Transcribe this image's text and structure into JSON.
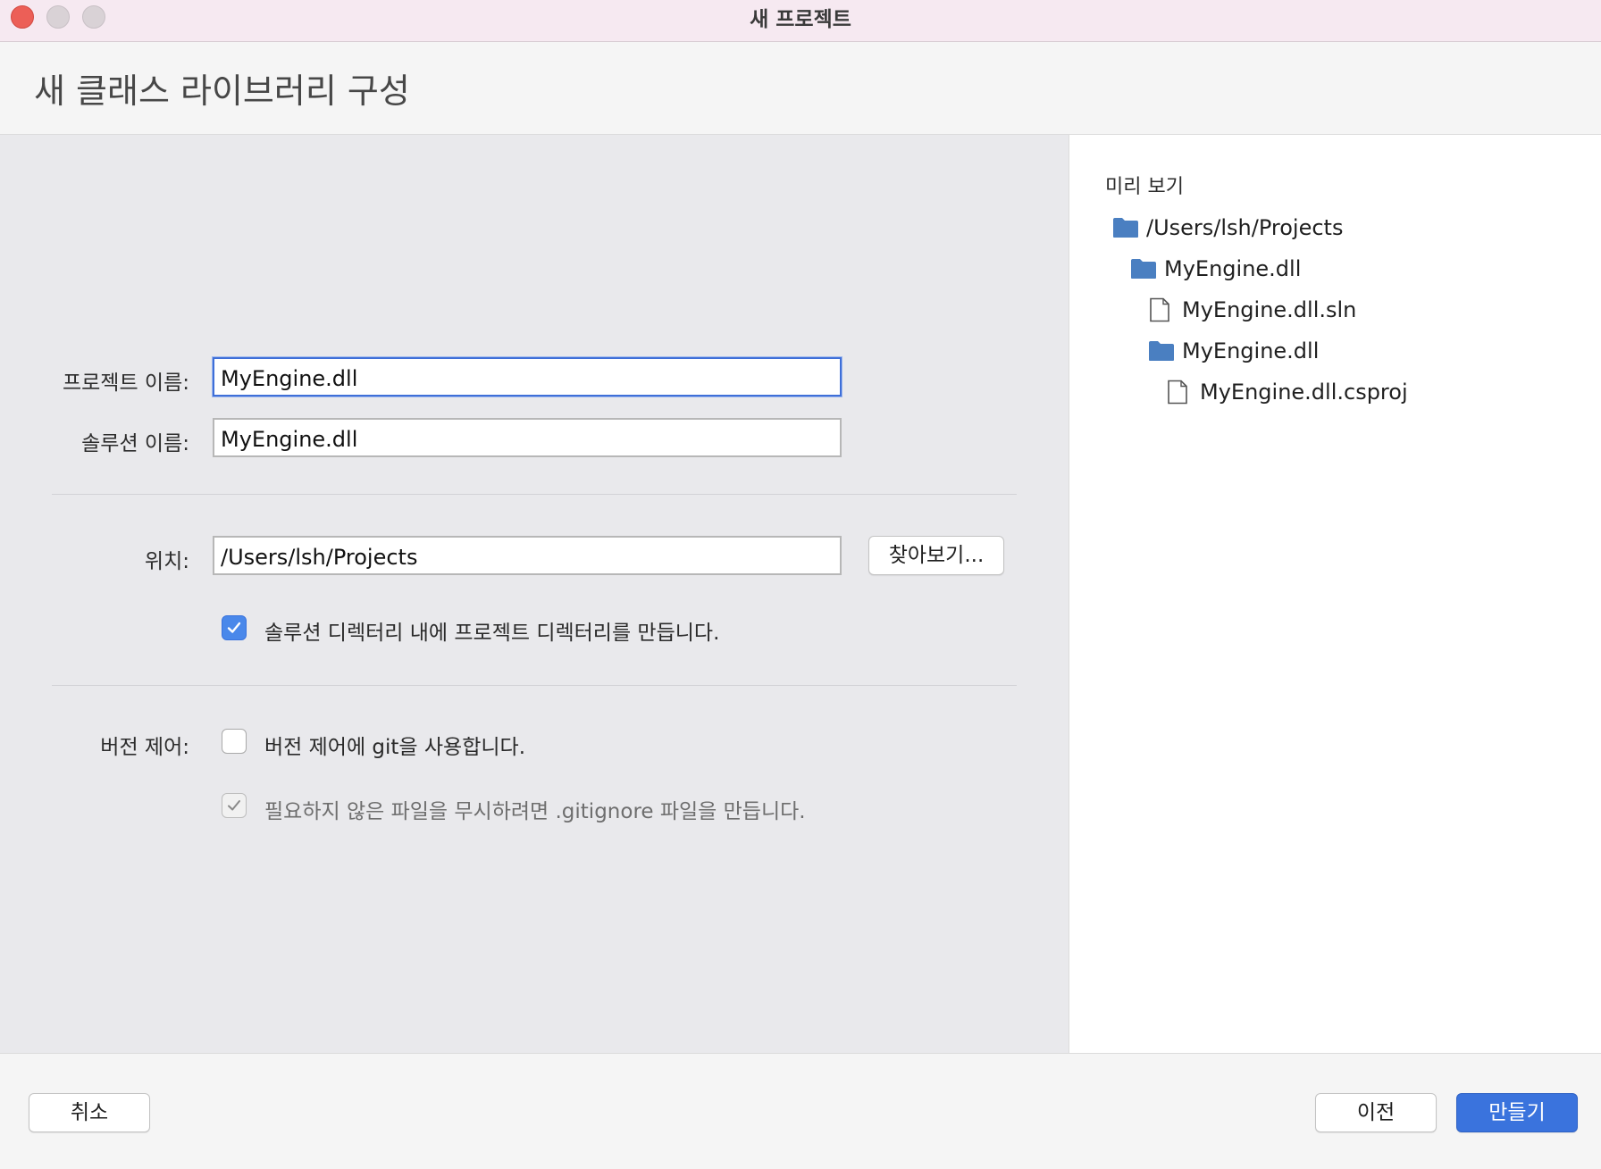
{
  "window": {
    "title": "새 프로젝트"
  },
  "header": {
    "title": "새 클래스 라이브러리 구성"
  },
  "form": {
    "project_name_label": "프로젝트 이름:",
    "project_name_value": "MyEngine.dll",
    "solution_name_label": "솔루션 이름:",
    "solution_name_value": "MyEngine.dll",
    "location_label": "위치:",
    "location_value": "/Users/lsh/Projects",
    "browse_label": "찾아보기...",
    "create_dir_checkbox_label": "솔루션 디렉터리 내에 프로젝트 디렉터리를 만듭니다.",
    "create_dir_checked": true,
    "vcs_label": "버전 제어:",
    "git_checkbox_label": "버전 제어에 git을 사용합니다.",
    "git_checked": false,
    "gitignore_checkbox_label": "필요하지 않은 파일을 무시하려면 .gitignore 파일을 만듭니다.",
    "gitignore_checked": true
  },
  "preview": {
    "title": "미리 보기",
    "items": [
      {
        "name": "/Users/lsh/Projects",
        "type": "folder",
        "depth": 0
      },
      {
        "name": "MyEngine.dll",
        "type": "folder",
        "depth": 1
      },
      {
        "name": "MyEngine.dll.sln",
        "type": "file",
        "depth": 2
      },
      {
        "name": "MyEngine.dll",
        "type": "folder",
        "depth": 2
      },
      {
        "name": "MyEngine.dll.csproj",
        "type": "file",
        "depth": 3
      }
    ]
  },
  "footer": {
    "cancel_label": "취소",
    "back_label": "이전",
    "create_label": "만들기"
  },
  "colors": {
    "accent": "#3a73dd",
    "folder": "#4a7fc1",
    "close_dot": "#ec5f57"
  }
}
